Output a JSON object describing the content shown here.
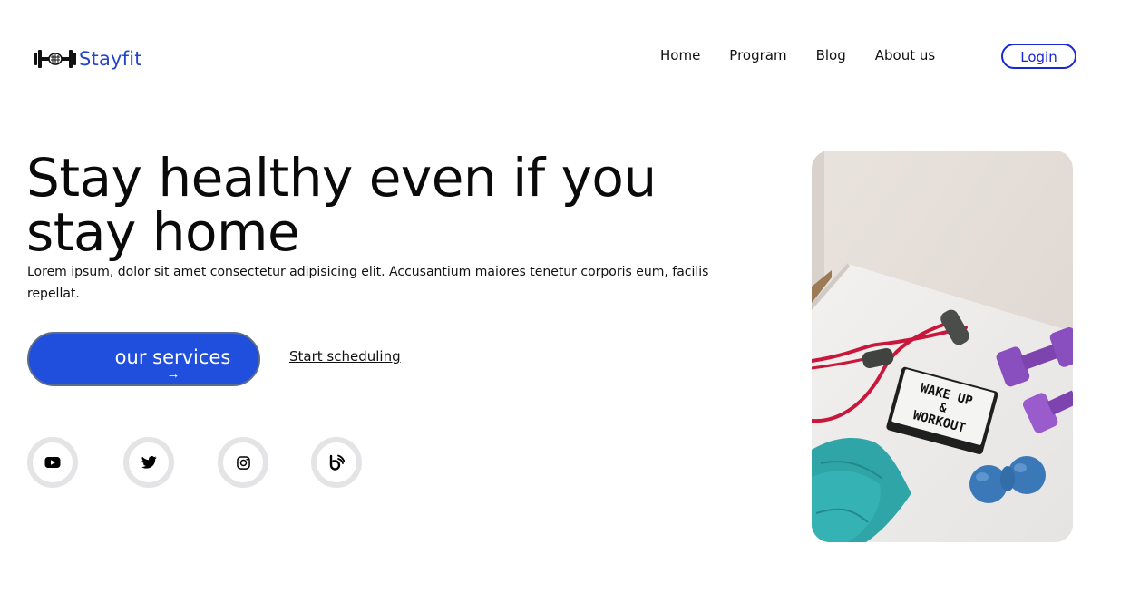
{
  "brand": {
    "name": "Stayfit",
    "logo_icon": "dumbbell-fist-icon",
    "color": "#2546c9"
  },
  "nav": {
    "items": [
      "Home",
      "Program",
      "Blog",
      "About us"
    ]
  },
  "login": {
    "label": "Login",
    "color": "#1a27d6"
  },
  "hero": {
    "headline": "Stay healthy even if you stay home",
    "lead": "Lorem ipsum, dolor sit amet consectetur adipisicing elit. Accusantium maiores tenetur corporis eum, facilis repellat.",
    "primary_button": {
      "label": "our services",
      "arrow": "→",
      "color": "#1f4fdc"
    },
    "secondary_link": "Start scheduling",
    "image": {
      "icon": "workout-equipment-photo",
      "lightbox_text": [
        "WAKE UP",
        "&",
        "WORKOUT"
      ]
    }
  },
  "social": [
    {
      "icon": "youtube-icon"
    },
    {
      "icon": "twitter-icon"
    },
    {
      "icon": "instagram-icon"
    },
    {
      "icon": "blog-icon"
    }
  ]
}
